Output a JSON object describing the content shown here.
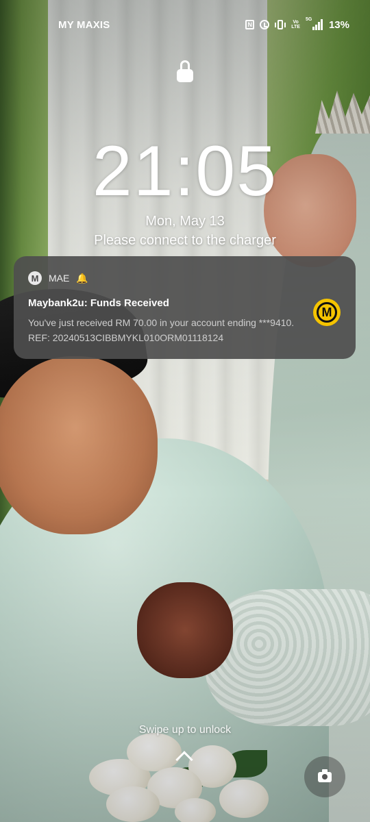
{
  "status_bar": {
    "carrier": "MY MAXIS",
    "nfc_glyph": "N",
    "volte_line1": "Vo",
    "volte_line2": "LTE",
    "network_label": "5G",
    "battery": "13%"
  },
  "lock_screen": {
    "time": "21:05",
    "date": "Mon, May 13",
    "charge_message": "Please connect to the charger"
  },
  "notification": {
    "app_initial": "M",
    "app_name": "MAE",
    "title": "Maybank2u: Funds Received",
    "body": "You've just received RM 70.00 in your account ending ***9410. REF: 20240513CIBBMYKL010ORM01118124",
    "logo_letter": "M",
    "logo_color": "#f5c400"
  },
  "bottom": {
    "swipe_hint": "Swipe up to unlock"
  },
  "icons": {
    "status": [
      "nfc-icon",
      "alarm-icon",
      "vibrate-icon",
      "volte-icon",
      "signal-icon"
    ],
    "lock": "lock-icon",
    "notification_bell": "bell-icon",
    "shortcut": "camera-icon"
  }
}
